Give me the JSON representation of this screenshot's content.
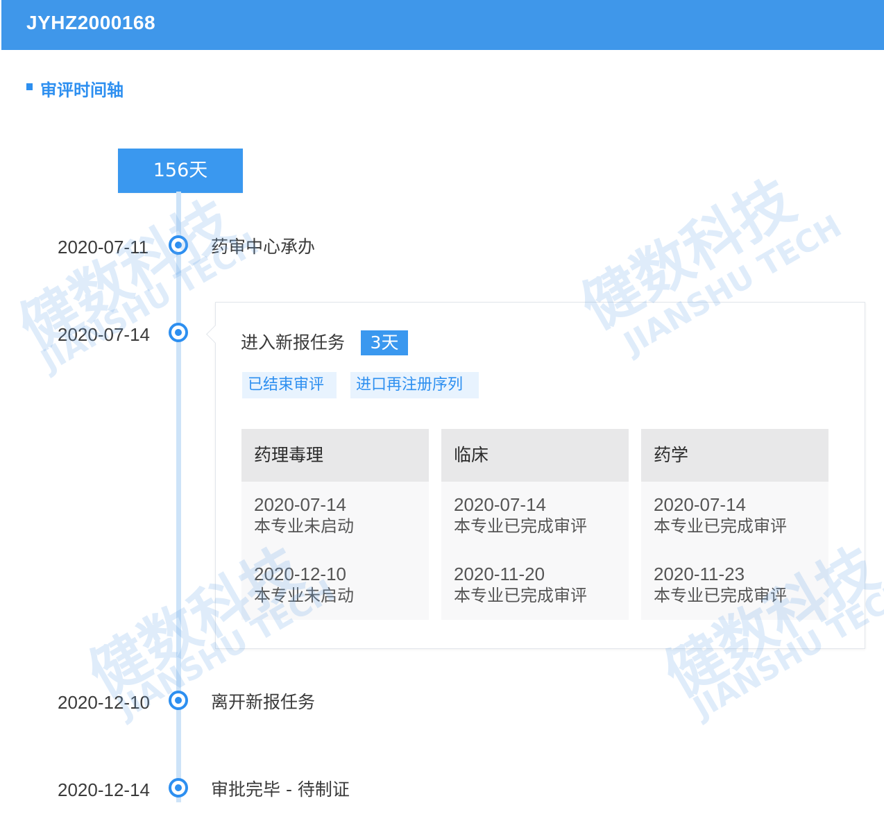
{
  "header": {
    "code": "JYHZ2000168"
  },
  "section": {
    "title": "审评时间轴"
  },
  "duration": {
    "total": "156天"
  },
  "timeline": [
    {
      "date": "2020-07-11",
      "label": "药审中心承办"
    },
    {
      "date": "2020-07-14",
      "label": ""
    },
    {
      "date": "2020-12-10",
      "label": "离开新报任务"
    },
    {
      "date": "2020-12-14",
      "label": "审批完毕 - 待制证"
    }
  ],
  "task": {
    "title": "进入新报任务",
    "days": "3天",
    "tags": [
      "已结束审评",
      "进口再注册序列"
    ],
    "disciplines": [
      {
        "name": "药理毒理",
        "entries": [
          {
            "date": "2020-07-14",
            "status": "本专业未启动"
          },
          {
            "date": "2020-12-10",
            "status": "本专业未启动"
          }
        ]
      },
      {
        "name": "临床",
        "entries": [
          {
            "date": "2020-07-14",
            "status": "本专业已完成审评"
          },
          {
            "date": "2020-11-20",
            "status": "本专业已完成审评"
          }
        ]
      },
      {
        "name": "药学",
        "entries": [
          {
            "date": "2020-07-14",
            "status": "本专业已完成审评"
          },
          {
            "date": "2020-11-23",
            "status": "本专业已完成审评"
          }
        ]
      }
    ]
  },
  "watermark": {
    "cn": "健数科技",
    "en": "JIANSHU TECH"
  },
  "colors": {
    "primary": "#3f97ea",
    "accent": "#2d8ff0",
    "line": "#cde3f8"
  }
}
